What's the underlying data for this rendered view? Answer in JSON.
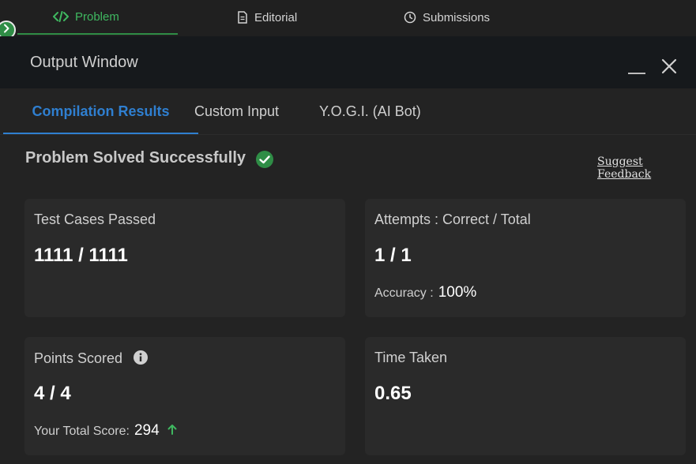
{
  "tabs": {
    "problem": "Problem",
    "editorial": "Editorial",
    "submissions": "Submissions"
  },
  "output_window": {
    "title": "Output Window"
  },
  "sub_tabs": {
    "compilation": "Compilation Results",
    "custom_input": "Custom Input",
    "yogi": "Y.O.G.I. (AI Bot)"
  },
  "status": {
    "title": "Problem Solved Successfully",
    "feedback": "Suggest Feedback"
  },
  "cards": {
    "test_cases": {
      "label": "Test Cases Passed",
      "value": "1111 / 1111"
    },
    "attempts": {
      "label": "Attempts : Correct / Total",
      "value": "1 / 1",
      "accuracy_label": "Accuracy :",
      "accuracy_value": "100%"
    },
    "points": {
      "label": "Points Scored",
      "value": "4 / 4",
      "total_label": "Your Total Score:",
      "total_value": "294"
    },
    "time": {
      "label": "Time Taken",
      "value": "0.65"
    }
  },
  "colors": {
    "accent_green": "#2f8d46",
    "accent_blue": "#2f7fd0",
    "background": "#232323",
    "card": "#2a2a2a"
  },
  "icons": [
    "code-icon",
    "document-icon",
    "clock-icon",
    "chevron-right-icon",
    "close-icon",
    "check-circle-icon",
    "info-icon",
    "arrow-up-icon"
  ]
}
